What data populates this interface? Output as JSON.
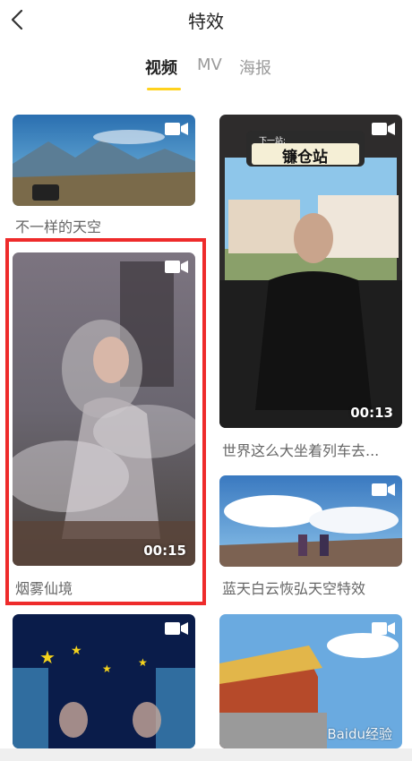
{
  "header": {
    "title": "特效",
    "back_icon": "chevron-left-icon"
  },
  "tabs": [
    {
      "label": "视频",
      "active": true
    },
    {
      "label": "MV",
      "active": false
    },
    {
      "label": "海报",
      "active": false
    }
  ],
  "colors": {
    "accent": "#FFD21E",
    "highlight": "#EE2B2B"
  },
  "cards": [
    {
      "caption": "不一样的天空",
      "duration": ""
    },
    {
      "caption": "世界这么大坐着列车去...",
      "duration": "00:13",
      "sign_small": "下一站:",
      "sign_big": "镰仓站"
    },
    {
      "caption": "烟雾仙境",
      "duration": "00:15"
    },
    {
      "caption": "蓝天白云恢弘天空特效",
      "duration": ""
    },
    {
      "caption": "",
      "duration": ""
    },
    {
      "caption": "",
      "duration": ""
    }
  ],
  "watermark": "Baidu经验"
}
